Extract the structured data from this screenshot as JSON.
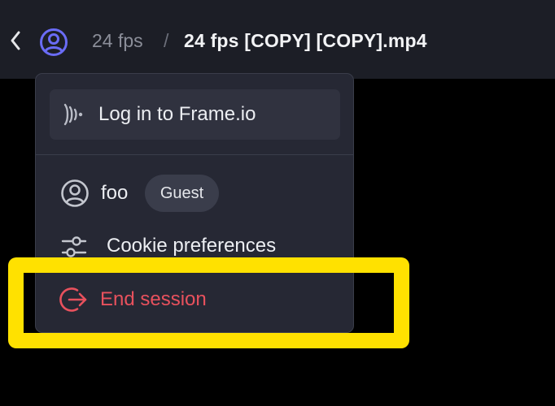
{
  "header": {
    "back_icon": "chevron-left-icon",
    "avatar_icon": "user-circle-icon",
    "breadcrumb_parent": "24 fps",
    "breadcrumb_separator": "/",
    "breadcrumb_current": "24 fps [COPY] [COPY].mp4"
  },
  "menu": {
    "login": {
      "icon": "frameio-logo-icon",
      "label": "Log in to Frame.io"
    },
    "user": {
      "icon": "user-circle-icon",
      "name": "foo",
      "badge": "Guest"
    },
    "cookie": {
      "icon": "sliders-icon",
      "label": "Cookie preferences"
    },
    "end_session": {
      "icon": "logout-icon",
      "label": "End session",
      "color": "#e8515d"
    }
  },
  "annotation": {
    "highlight_color": "#ffe100"
  }
}
